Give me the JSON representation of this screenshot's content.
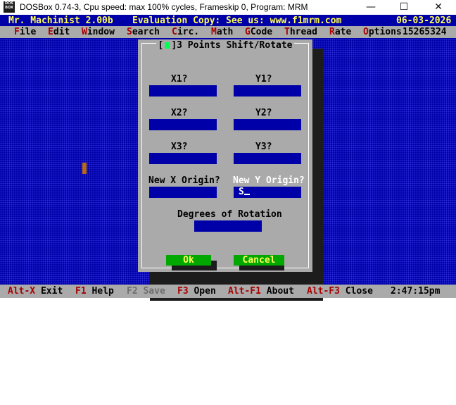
{
  "window": {
    "app_icon_text": "DOS BOX",
    "title": "DOSBox 0.74-3, Cpu speed:   max 100% cycles, Frameskip  0, Program:    MRM",
    "minimize_glyph": "—",
    "maximize_glyph": "☐",
    "close_glyph": "✕"
  },
  "dos": {
    "title_left": "Mr. Machinist 2.00b",
    "title_center": "Evaluation Copy: See us: www.f1mrm.com",
    "title_date": "06-03-2026",
    "menu": [
      {
        "hot": "F",
        "rest": "ile"
      },
      {
        "hot": "E",
        "rest": "dit"
      },
      {
        "hot": "W",
        "rest": "indow"
      },
      {
        "hot": "S",
        "rest": "earch"
      },
      {
        "hot": "C",
        "rest": "irc."
      },
      {
        "hot": "M",
        "rest": "ath"
      },
      {
        "hot": "G",
        "rest": "Code"
      },
      {
        "hot": "T",
        "rest": "hread"
      },
      {
        "hot": "R",
        "rest": "ate"
      },
      {
        "hot": "O",
        "rest": "ptions"
      }
    ],
    "menu_number": "15265324"
  },
  "dialog": {
    "title": "3 Points Shift/Rotate",
    "labels": {
      "x1": "X1?",
      "y1": "Y1?",
      "x2": "X2?",
      "y2": "Y2?",
      "x3": "X3?",
      "y3": "Y3?",
      "new_x": "New X Origin?",
      "new_y": "New Y Origin?",
      "degrees": "Degrees of Rotation"
    },
    "values": {
      "x1": "",
      "y1": "",
      "x2": "",
      "y2": "",
      "x3": "",
      "y3": "",
      "new_x": "",
      "new_y": "S",
      "degrees": ""
    },
    "ok_label": "Ok",
    "cancel_label": "Cancel"
  },
  "status": {
    "items": [
      {
        "key": "Alt-X",
        "label": "Exit",
        "enabled": true
      },
      {
        "key": "F1",
        "label": "Help",
        "enabled": true
      },
      {
        "key": "F2",
        "label": "Save",
        "enabled": false
      },
      {
        "key": "F3",
        "label": "Open",
        "enabled": true
      },
      {
        "key": "Alt-F1",
        "label": "About",
        "enabled": true
      },
      {
        "key": "Alt-F3",
        "label": "Close",
        "enabled": true
      }
    ],
    "clock": "2:47:15pm"
  },
  "colors": {
    "dos_blue": "#0000a8",
    "dialog_grey": "#aaaaaa",
    "hotkey_red": "#a80000",
    "button_green": "#00a800",
    "title_yellow": "#ffff55"
  }
}
